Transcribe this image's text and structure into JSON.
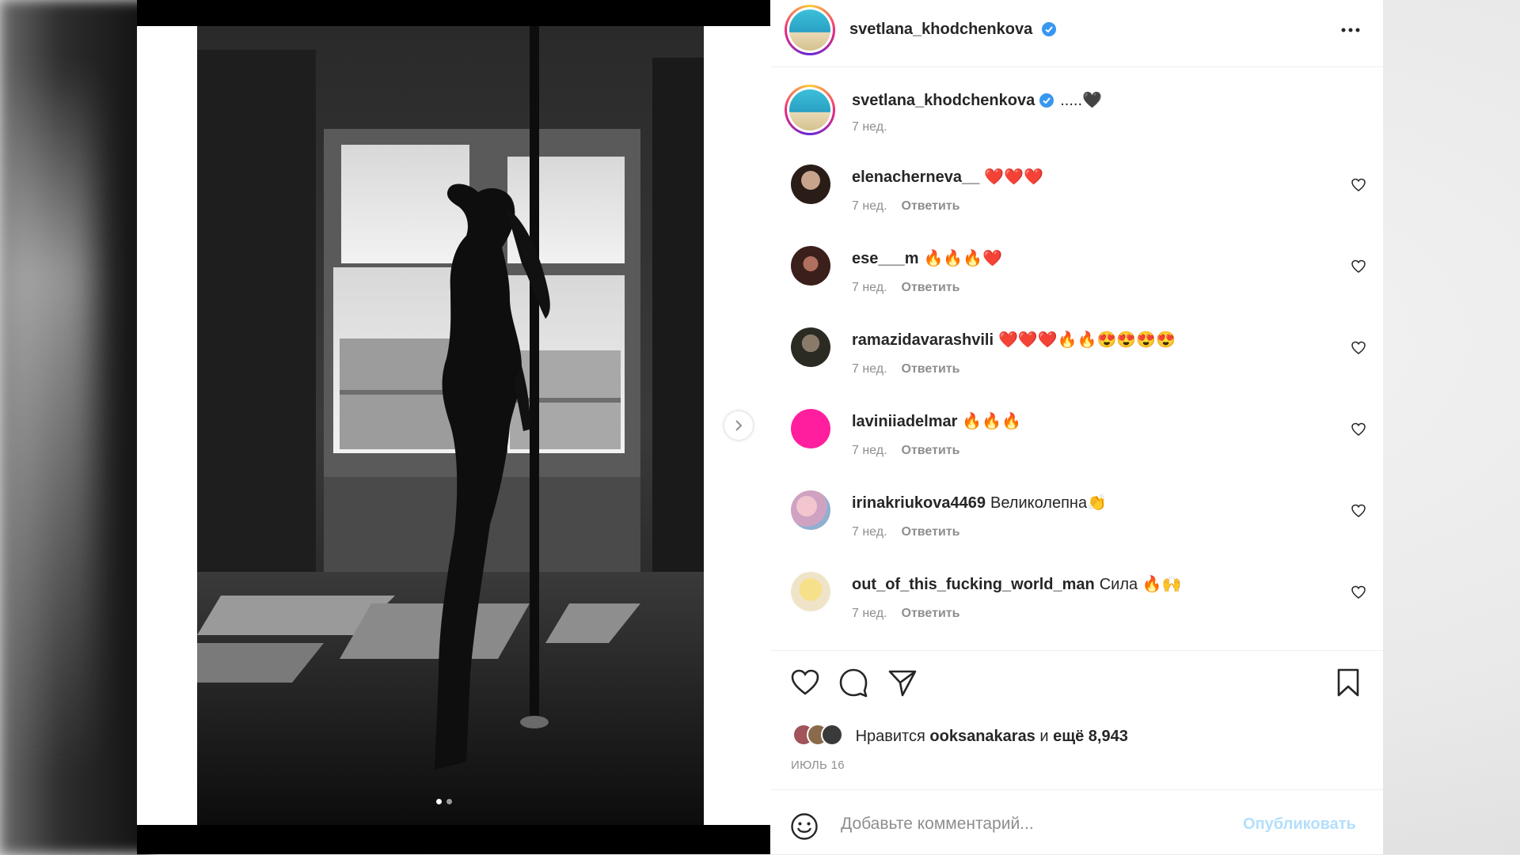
{
  "post": {
    "username": "svetlana_khodchenkova",
    "caption": ".....🖤",
    "caption_time": "7 нед.",
    "carousel": {
      "count": 2,
      "active_index": 0
    }
  },
  "comments": [
    {
      "username": "elenacherneva__",
      "text": "❤️❤️❤️",
      "time": "7 нед.",
      "reply": "Ответить"
    },
    {
      "username": "ese___m",
      "text": "🔥🔥🔥❤️",
      "time": "7 нед.",
      "reply": "Ответить"
    },
    {
      "username": "ramazidavarashvili",
      "text": "❤️❤️❤️🔥🔥😍😍😍😍",
      "time": "7 нед.",
      "reply": "Ответить"
    },
    {
      "username": "laviniiadelmar",
      "text": "🔥🔥🔥",
      "time": "7 нед.",
      "reply": "Ответить"
    },
    {
      "username": "irinakriukova4469",
      "text": "Великолепна👏",
      "time": "7 нед.",
      "reply": "Ответить"
    },
    {
      "username": "out_of_this_fucking_world_man",
      "text": "Сила 🔥🙌",
      "time": "7 нед.",
      "reply": "Ответить"
    }
  ],
  "likes": {
    "prefix": "Нравится",
    "user": "ooksanakaras",
    "joiner": "и",
    "rest": "ещё 8,943"
  },
  "date": "ИЮЛЬ 16",
  "comment_box": {
    "placeholder": "Добавьте комментарий...",
    "publish": "Опубликовать"
  },
  "colors": {
    "verified": "#3897f0",
    "publish_disabled": "#b2dffc",
    "muted": "#8e8e8e",
    "laviniia_avatar": "#ff1f9e"
  },
  "icons": [
    "more-icon",
    "like-icon",
    "comment-icon",
    "share-icon",
    "save-icon",
    "smile-icon",
    "chevron-right-icon",
    "verified-icon"
  ]
}
